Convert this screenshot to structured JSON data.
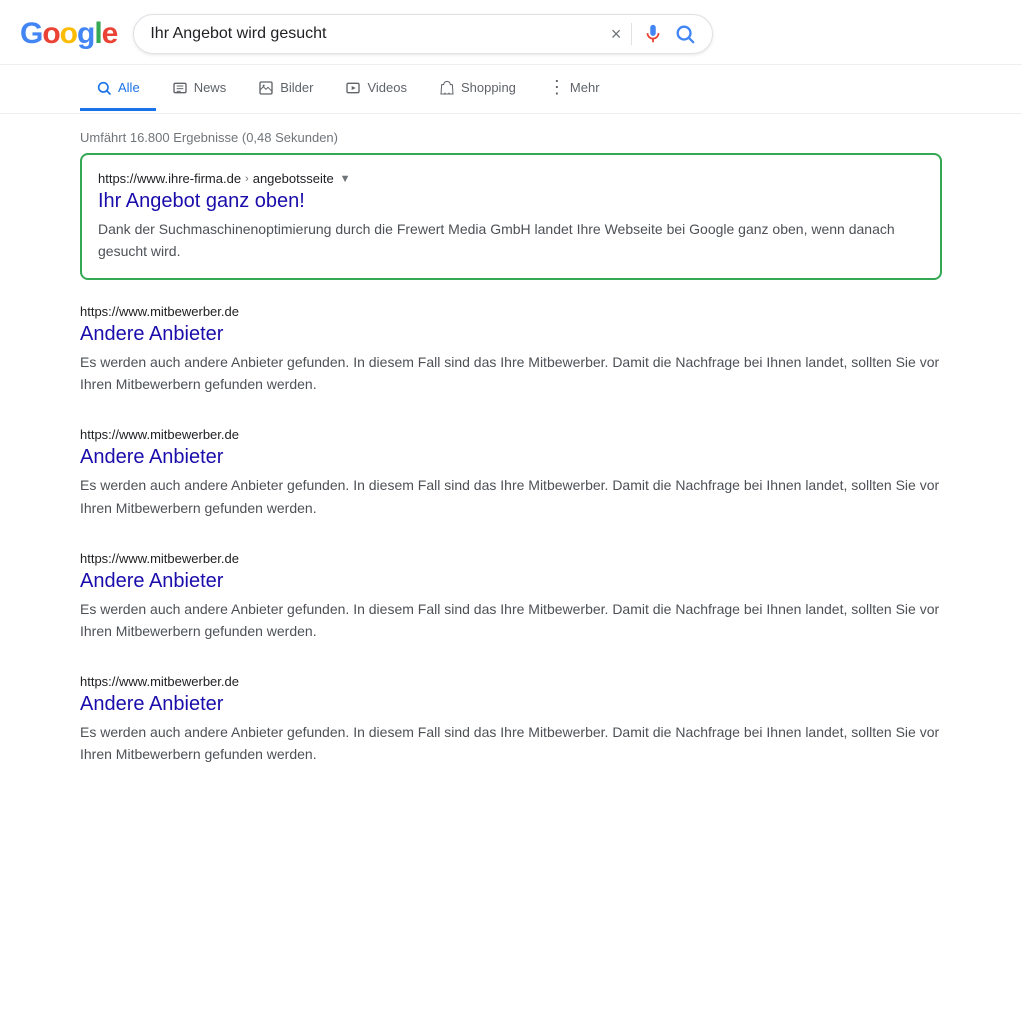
{
  "header": {
    "logo": {
      "g": "G",
      "o1": "o",
      "o2": "o",
      "g2": "g",
      "l": "l",
      "e": "e"
    },
    "search_value": "Ihr Angebot wird gesucht",
    "clear_icon": "×",
    "search_icon": "🔍"
  },
  "nav": {
    "tabs": [
      {
        "id": "alle",
        "label": "Alle",
        "active": true
      },
      {
        "id": "news",
        "label": "News",
        "active": false
      },
      {
        "id": "bilder",
        "label": "Bilder",
        "active": false
      },
      {
        "id": "videos",
        "label": "Videos",
        "active": false
      },
      {
        "id": "shopping",
        "label": "Shopping",
        "active": false
      },
      {
        "id": "mehr",
        "label": "Mehr",
        "active": false
      }
    ]
  },
  "results_info": "Umfährt 16.800 Ergebnisse (0,48 Sekunden)",
  "featured_result": {
    "url": "https://www.ihre-firma.de",
    "breadcrumb": "angebotsseite",
    "title": "Ihr Angebot ganz oben!",
    "snippet": "Dank der Suchmaschinenoptimierung durch die Frewert Media GmbH landet Ihre Webseite bei Google ganz oben, wenn danach gesucht wird."
  },
  "other_results": [
    {
      "url": "https://www.mitbewerber.de",
      "title": "Andere Anbieter",
      "snippet": "Es werden auch andere Anbieter gefunden. In diesem Fall sind das Ihre Mitbewerber. Damit die Nachfrage bei Ihnen landet, sollten Sie vor Ihren Mitbewerbern gefunden werden."
    },
    {
      "url": "https://www.mitbewerber.de",
      "title": "Andere Anbieter",
      "snippet": "Es werden auch andere Anbieter gefunden. In diesem Fall sind das Ihre Mitbewerber. Damit die Nachfrage bei Ihnen landet, sollten Sie vor Ihren Mitbewerbern gefunden werden."
    },
    {
      "url": "https://www.mitbewerber.de",
      "title": "Andere Anbieter",
      "snippet": "Es werden auch andere Anbieter gefunden. In diesem Fall sind das Ihre Mitbewerber. Damit die Nachfrage bei Ihnen landet, sollten Sie vor Ihren Mitbewerbern gefunden werden."
    },
    {
      "url": "https://www.mitbewerber.de",
      "title": "Andere Anbieter",
      "snippet": "Es werden auch andere Anbieter gefunden. In diesem Fall sind das Ihre Mitbewerber. Damit die Nachfrage bei Ihnen landet, sollten Sie vor Ihren Mitbewerbern gefunden werden."
    }
  ],
  "colors": {
    "google_blue": "#4285F4",
    "google_red": "#EA4335",
    "google_yellow": "#FBBC05",
    "google_green": "#34A853",
    "link_color": "#1a0dab",
    "featured_border": "#34A853"
  }
}
